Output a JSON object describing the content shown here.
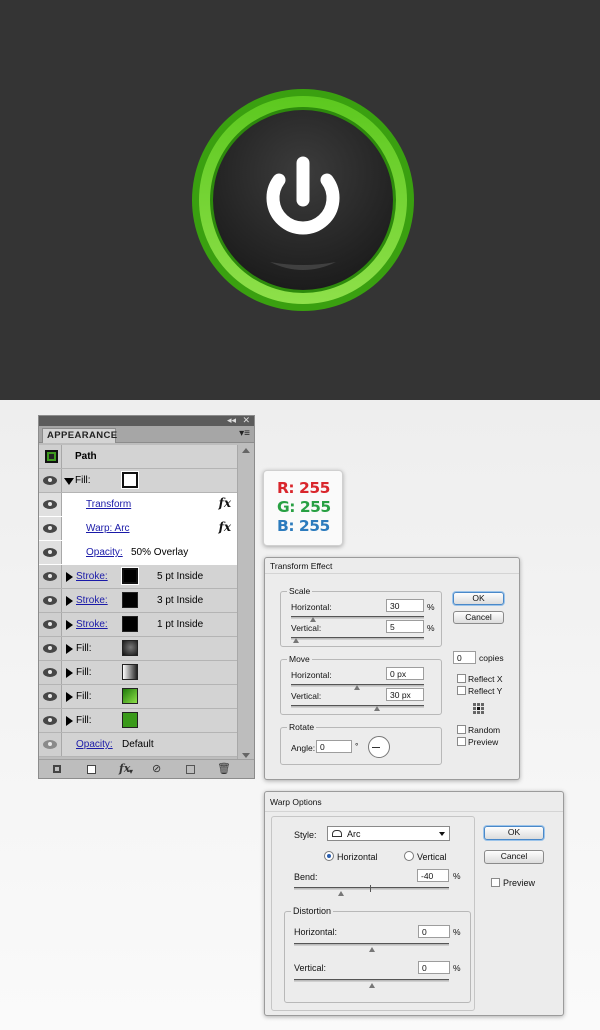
{
  "colors": {
    "dark_bg": "#343434",
    "green_ring": "#56c41c",
    "power_symbol": "#ffffff"
  },
  "artwork": {
    "icon": "power-symbol-icon"
  },
  "appearance": {
    "tab": "APPEARANCE",
    "title": "Path",
    "rows": [
      {
        "type": "fill",
        "label": "Fill:",
        "swatch": "#ffffff",
        "expanded": true
      },
      {
        "type": "effect",
        "label": "Transform",
        "fx": "fx"
      },
      {
        "type": "effect",
        "label": "Warp: Arc",
        "fx": "fx"
      },
      {
        "type": "opacity",
        "label": "Opacity:",
        "value": "50% Overlay"
      },
      {
        "type": "stroke",
        "label": "Stroke:",
        "swatch": "#000000",
        "value": "5 pt  Inside"
      },
      {
        "type": "stroke",
        "label": "Stroke:",
        "swatch": "#000000",
        "value": "3 pt  Inside"
      },
      {
        "type": "stroke",
        "label": "Stroke:",
        "swatch": "#000000",
        "value": "1 pt  Inside"
      },
      {
        "type": "fill",
        "label": "Fill:",
        "swatch": "radial-dark"
      },
      {
        "type": "fill",
        "label": "Fill:",
        "swatch": "linear-grey"
      },
      {
        "type": "fill",
        "label": "Fill:",
        "swatch": "green-gradient"
      },
      {
        "type": "fill",
        "label": "Fill:",
        "swatch": "#3a9a1a"
      },
      {
        "type": "opacity",
        "label": "Opacity:",
        "value": "Default"
      }
    ],
    "bottom_icons": [
      "new-art-icon",
      "clear-appearance-icon",
      "fx-icon",
      "no-icon",
      "duplicate-icon",
      "trash-icon"
    ]
  },
  "rgb": {
    "r": "R: 255",
    "g": "G: 255",
    "b": "B: 255",
    "r_color": "#d9262c",
    "g_color": "#28a043",
    "b_color": "#2c7bbd"
  },
  "transform": {
    "title": "Transform Effect",
    "scale": {
      "label": "Scale",
      "horizontal_label": "Horizontal:",
      "horizontal": "30",
      "vertical_label": "Vertical:",
      "vertical": "5",
      "unit": "%"
    },
    "move": {
      "label": "Move",
      "horizontal_label": "Horizontal:",
      "horizontal": "0 px",
      "vertical_label": "Vertical:",
      "vertical": "30 px"
    },
    "rotate": {
      "label": "Rotate",
      "angle_label": "Angle:",
      "angle": "0",
      "unit": "°"
    },
    "ok": "OK",
    "cancel": "Cancel",
    "copies": "0",
    "copies_label": "copies",
    "reflect_x": "Reflect X",
    "reflect_y": "Reflect Y",
    "random": "Random",
    "preview": "Preview"
  },
  "warp": {
    "title": "Warp Options",
    "style_label": "Style:",
    "style": "Arc",
    "horizontal": "Horizontal",
    "vertical": "Vertical",
    "bend_label": "Bend:",
    "bend": "-40",
    "unit": "%",
    "distortion": "Distortion",
    "dist_h_label": "Horizontal:",
    "dist_h": "0",
    "dist_v_label": "Vertical:",
    "dist_v": "0",
    "ok": "OK",
    "cancel": "Cancel",
    "preview": "Preview"
  }
}
